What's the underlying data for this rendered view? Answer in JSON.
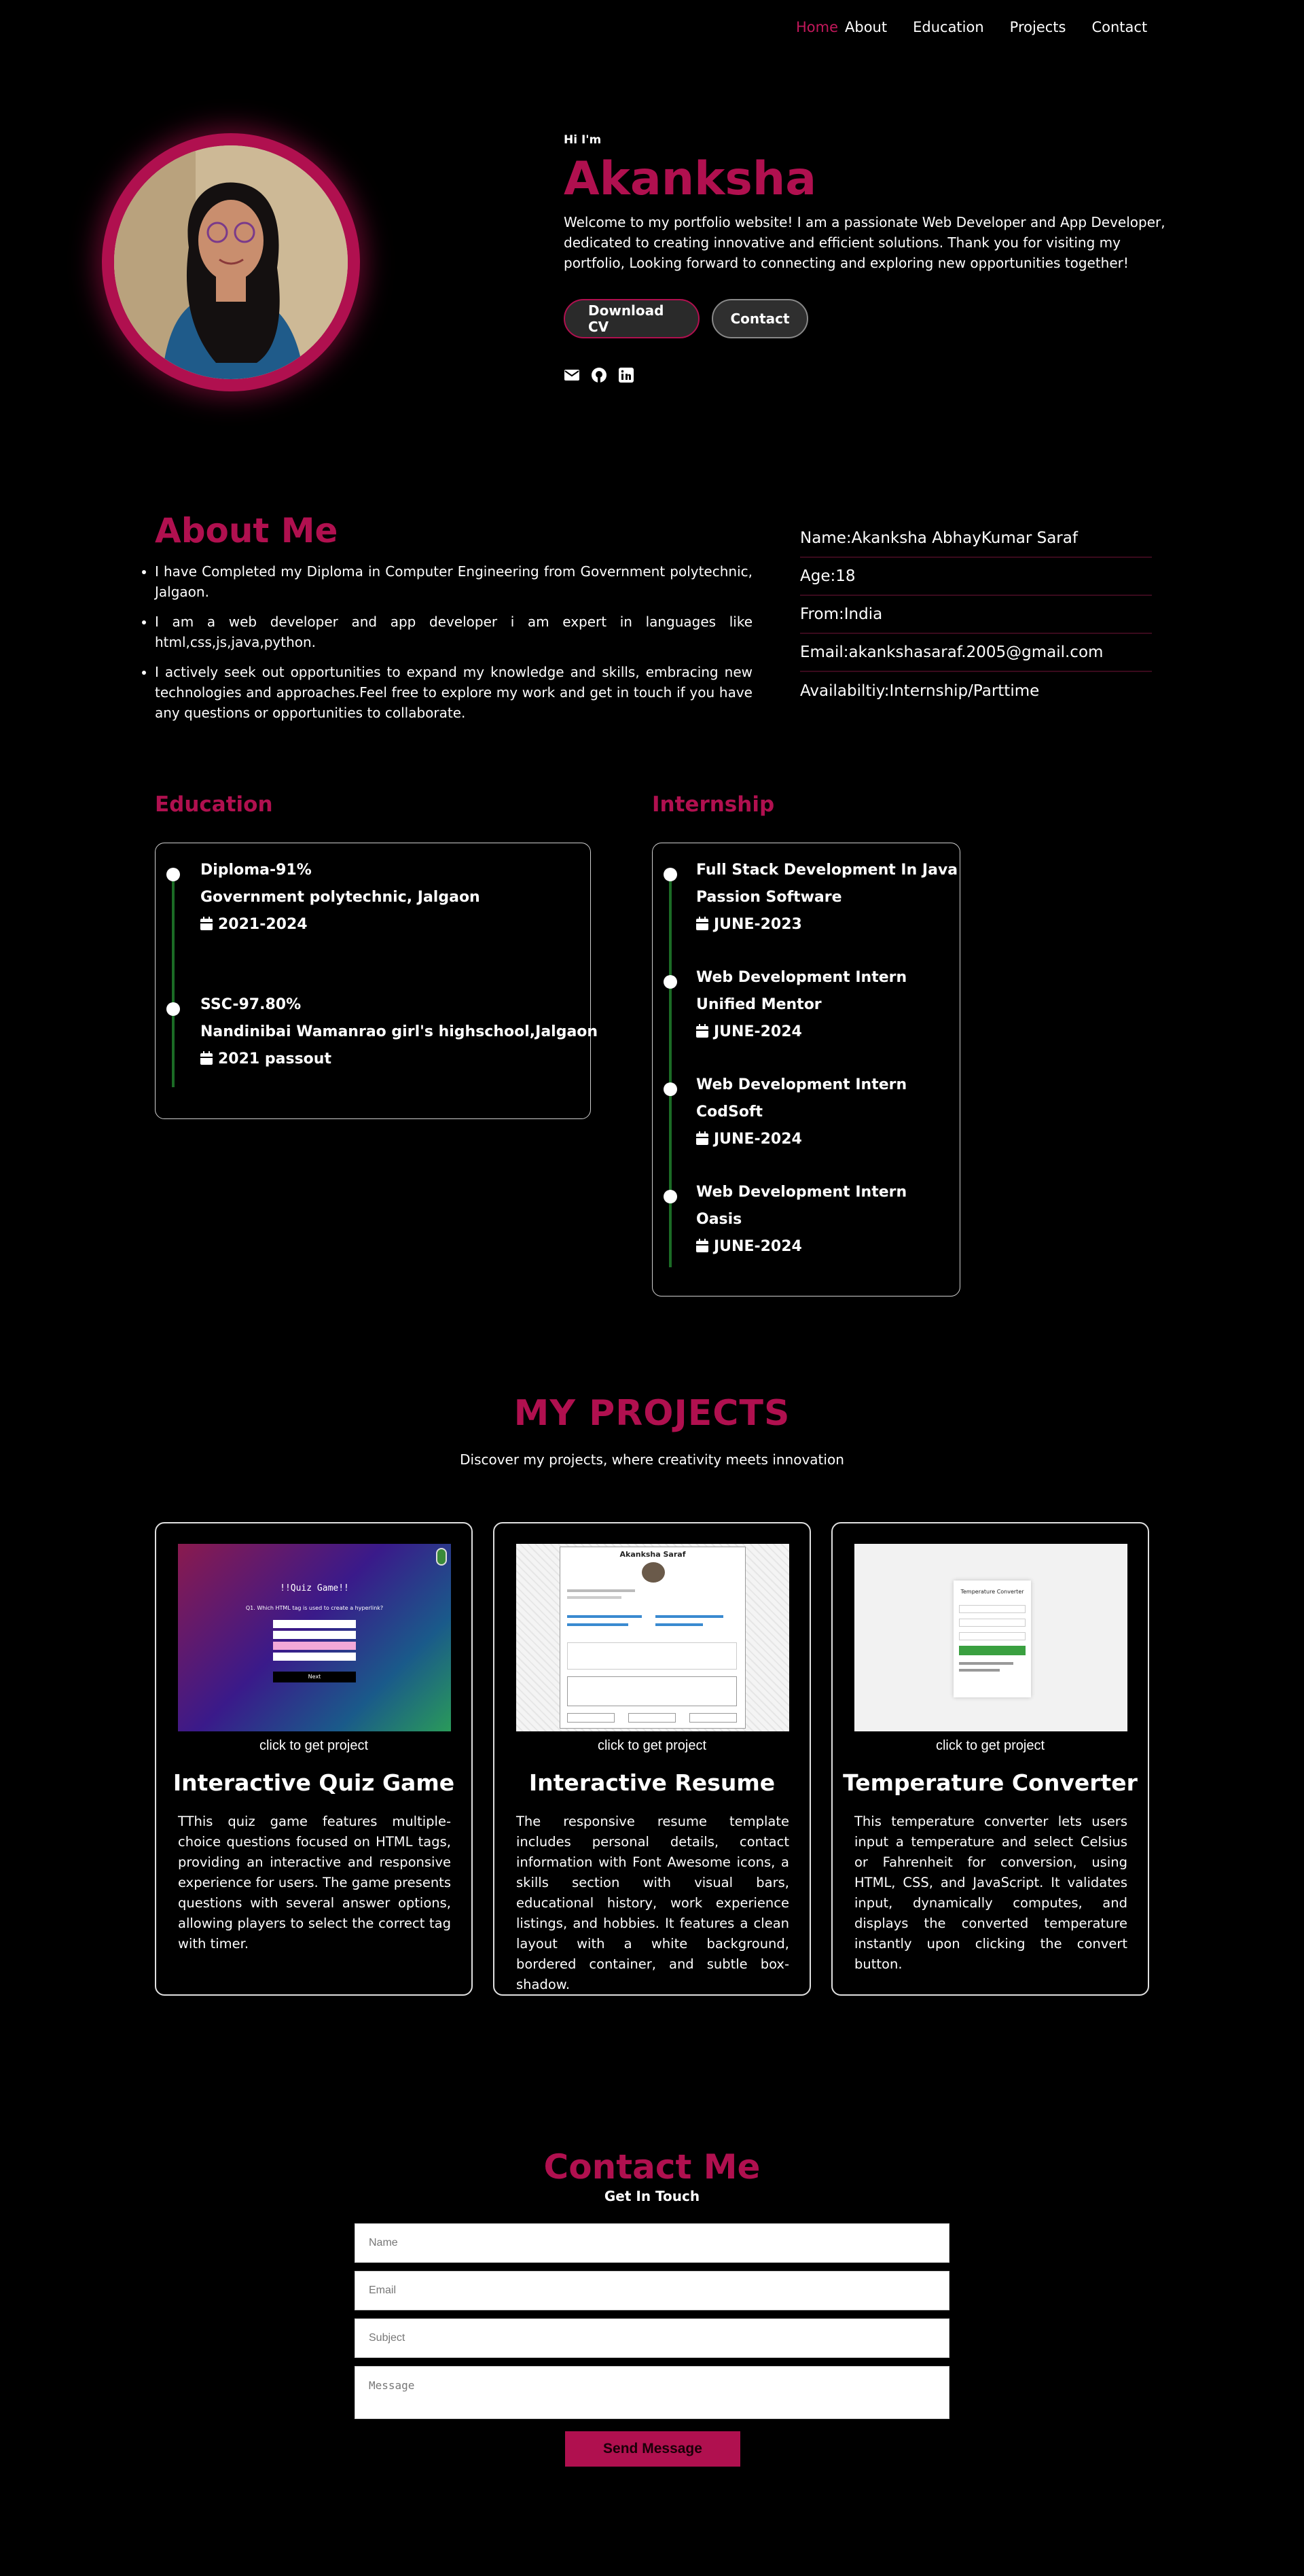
{
  "nav": {
    "items": [
      "Home",
      "About",
      "Education",
      "Projects",
      "Contact"
    ]
  },
  "hero": {
    "greeting": "Hi I'm",
    "name": "Akanksha",
    "description": "Welcome to my portfolio website! I am a passionate Web Developer and App Developer, dedicated to creating innovative and efficient solutions. Thank you for visiting my portfolio, Looking forward to connecting and exploring new opportunities together!",
    "download_cv": "Download CV",
    "contact": "Contact",
    "socials": [
      "envelope-icon",
      "github-icon",
      "linkedin-icon"
    ]
  },
  "about": {
    "title": "About Me",
    "bullets": [
      "I have Completed my Diploma in Computer Engineering from Government polytechnic, Jalgaon.",
      "I am a web developer and app developer i am expert in languages like html,css,js,java,python.",
      "I actively seek out opportunities to expand my knowledge and skills, embracing new technologies and approaches.Feel free to explore my work and get in touch if you have any questions or opportunities to collaborate."
    ],
    "info": [
      "Name:Akanksha AbhayKumar Saraf",
      "Age:18",
      "From:India",
      "Email:akankshasaraf.2005@gmail.com",
      "Availabiltiy:Internship/Parttime"
    ]
  },
  "education": {
    "title": "Education",
    "items": [
      {
        "title": "Diploma-91%",
        "place": "Government polytechnic, Jalgaon",
        "date": "2021-2024"
      },
      {
        "title": "SSC-97.80%",
        "place": "Nandinibai Wamanrao girl's highschool,Jalgaon",
        "date": "2021 passout"
      }
    ]
  },
  "internship": {
    "title": "Internship",
    "items": [
      {
        "title": "Full Stack Development In Java",
        "place": "Passion Software",
        "date": "JUNE-2023"
      },
      {
        "title": "Web Development Intern",
        "place": "Unified Mentor",
        "date": "JUNE-2024"
      },
      {
        "title": "Web Development Intern",
        "place": "CodSoft",
        "date": "JUNE-2024"
      },
      {
        "title": "Web Development Intern",
        "place": "Oasis",
        "date": "JUNE-2024"
      }
    ]
  },
  "projects": {
    "title": "MY PROJECTS",
    "subtitle": "Discover my projects, where creativity meets innovation",
    "cards": [
      {
        "link": "click to get project",
        "title": "Interactive Quiz Game",
        "description": "TThis quiz game features multiple-choice questions focused on HTML tags, providing an interactive and responsive experience for users. The game presents questions with several answer options, allowing players to select the correct tag with timer.",
        "thumb": {
          "heading": "!!Quiz Game!!",
          "question": "Q1. Which HTML tag is used to create a hyperlink?",
          "button": "Next"
        }
      },
      {
        "link": "click to get project",
        "title": "Interactive Resume",
        "description": "The responsive resume template includes personal details, contact information with Font Awesome icons, a skills section with visual bars, educational history, work experience listings, and hobbies. It features a clean layout with a white background, bordered container, and subtle box-shadow.",
        "thumb": {
          "heading": "Akanksha Saraf"
        }
      },
      {
        "link": "click to get project",
        "title": "Temperature Converter",
        "description": "This temperature converter lets users input a temperature and select Celsius or Fahrenheit for conversion, using HTML, CSS, and JavaScript. It validates input, dynamically computes, and displays the converted temperature instantly upon clicking the convert button.",
        "thumb": {
          "heading": "Temperature Converter"
        }
      }
    ]
  },
  "contact": {
    "title": "Contact Me",
    "subtitle": "Get In Touch",
    "name_ph": "Name",
    "email_ph": "Email",
    "subject_ph": "Subject",
    "message_ph": "Message",
    "send": "Send Message"
  },
  "colors": {
    "accent": "#b0104f",
    "timeline": "#1b6b25",
    "background": "#000000"
  }
}
